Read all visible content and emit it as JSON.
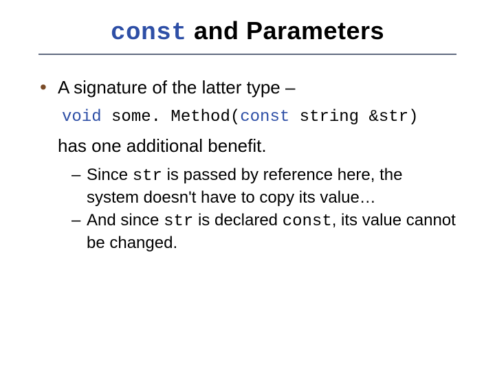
{
  "title": {
    "keyword": "const",
    "rest": " and Parameters"
  },
  "bullet": {
    "lead": "A signature of the latter type –",
    "code": {
      "t1": "void",
      "t2": " some. Method(",
      "t3": "const",
      "t4": " string &str)"
    },
    "continuation": "has one additional benefit.",
    "subs": {
      "a": {
        "p1": "Since ",
        "p2": "str",
        "p3": " is passed by reference here, the system doesn't have to copy its value…"
      },
      "b": {
        "p1": "And since ",
        "p2": "str",
        "p3": " is declared ",
        "p4": "const",
        "p5": ", its value cannot be changed."
      }
    }
  }
}
